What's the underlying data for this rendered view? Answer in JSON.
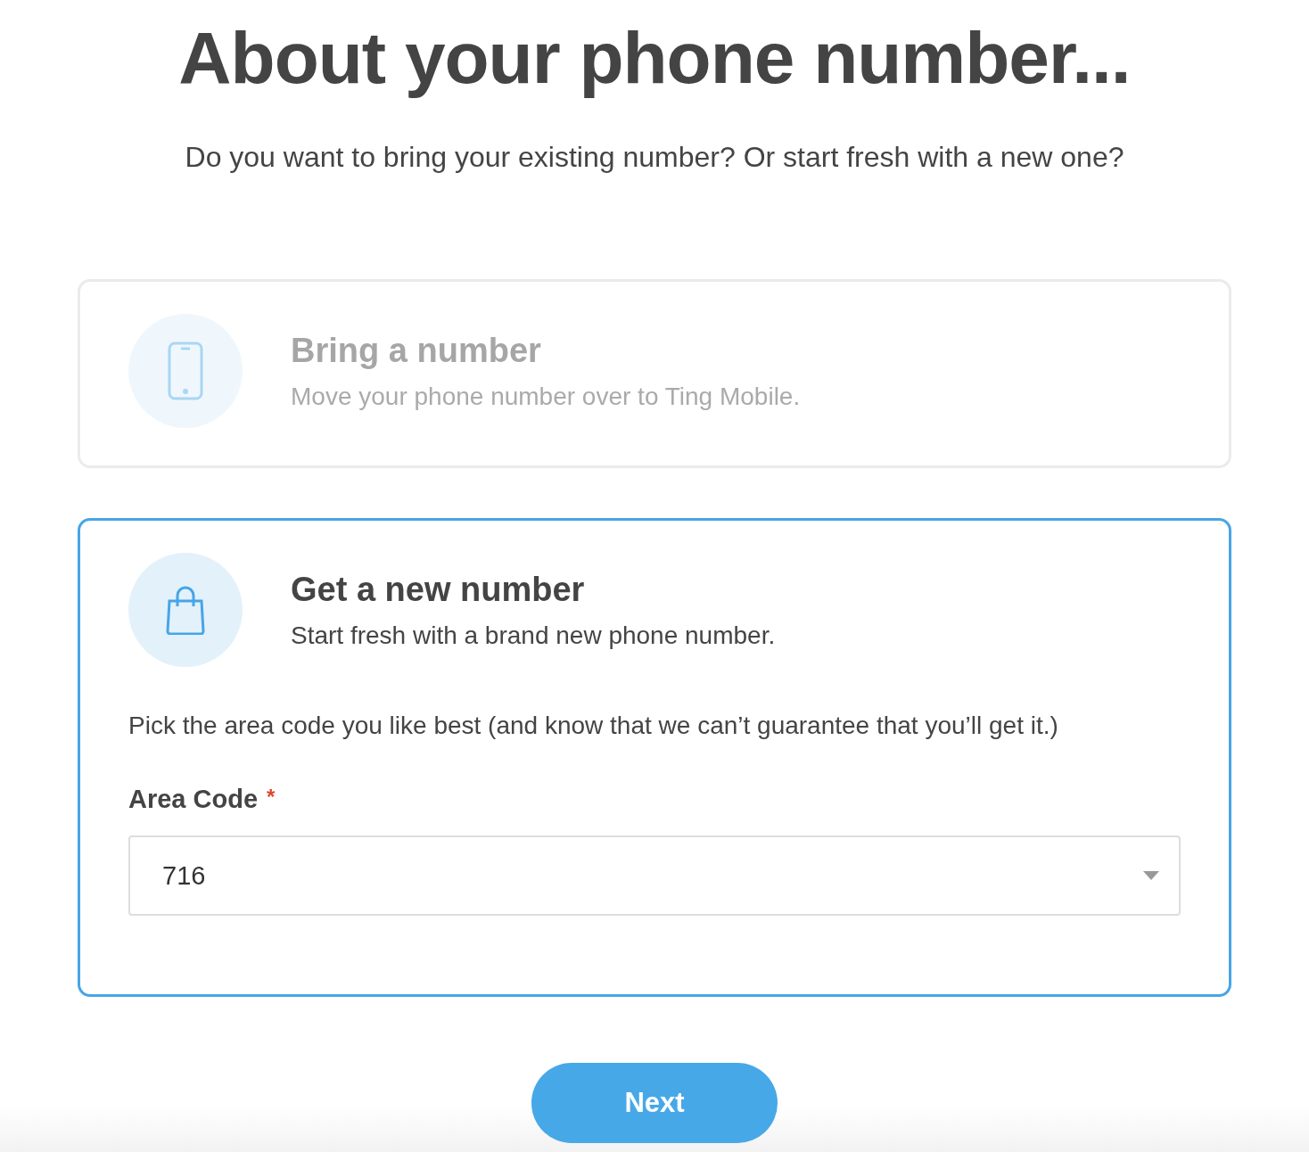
{
  "heading": "About your phone number...",
  "subtitle": "Do you want to bring your existing number? Or start fresh with a new one?",
  "options": [
    {
      "kind": "phone",
      "title": "Bring a number",
      "description": "Move your phone number over to Ting Mobile.",
      "selected": false
    },
    {
      "kind": "bag",
      "title": "Get a new number",
      "description": "Start fresh with a brand new phone number.",
      "selected": true,
      "note": "Pick the area code you like best (and know that we can’t guarantee that you’ll get it.)",
      "field": {
        "label": "Area Code",
        "required_mark": "*",
        "value": "716"
      }
    }
  ],
  "next_button": "Next"
}
